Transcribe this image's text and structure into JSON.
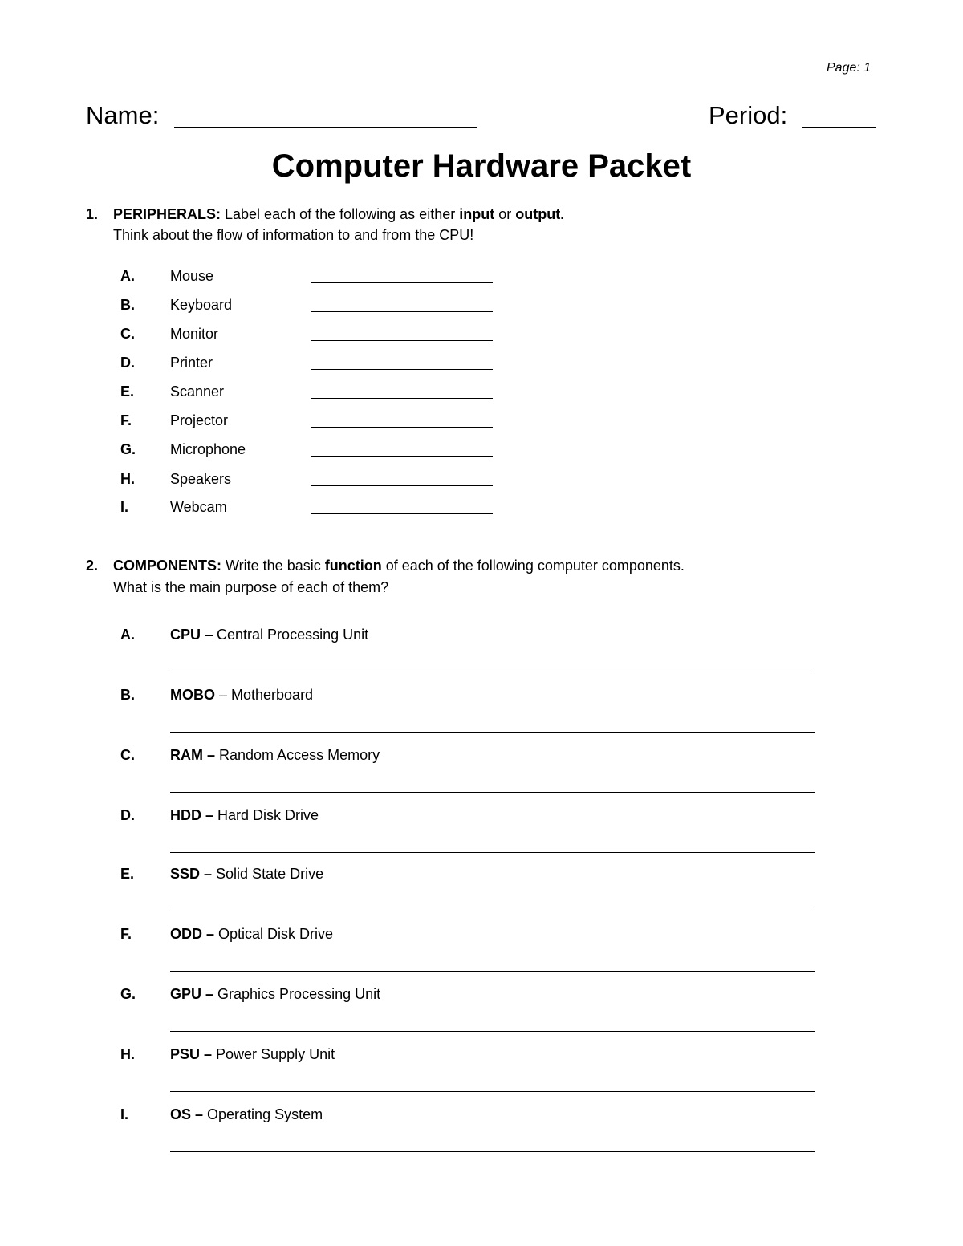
{
  "page_label": "Page: 1",
  "header": {
    "name_label": "Name:",
    "period_label": "Period:"
  },
  "title": "Computer Hardware Packet",
  "q1": {
    "number": "1.",
    "heading": "PERIPHERALS:",
    "text_a": " Label each of the following as either ",
    "bold_input": "input",
    "text_b": " or ",
    "bold_output": "output.",
    "line2": "Think about the flow of information to and from the CPU!",
    "items": [
      {
        "letter": "A.",
        "label": "Mouse"
      },
      {
        "letter": "B.",
        "label": "Keyboard"
      },
      {
        "letter": "C.",
        "label": "Monitor"
      },
      {
        "letter": "D.",
        "label": "Printer"
      },
      {
        "letter": "E.",
        "label": "Scanner"
      },
      {
        "letter": "F.",
        "label": "Projector"
      },
      {
        "letter": "G.",
        "label": "Microphone"
      },
      {
        "letter": "H.",
        "label": "Speakers"
      },
      {
        "letter": "I.",
        "label": "Webcam"
      }
    ]
  },
  "q2": {
    "number": "2.",
    "heading": "COMPONENTS:",
    "text_a": " Write the basic ",
    "bold_function": "function",
    "text_b": " of each of the following computer components.",
    "line2": "What is the main purpose of each of them?",
    "items": [
      {
        "letter": "A.",
        "abbr": "CPU",
        "full": " – Central Processing Unit"
      },
      {
        "letter": "B.",
        "abbr": "MOBO",
        "full": " – Motherboard"
      },
      {
        "letter": "C.",
        "abbr": "RAM –",
        "full": " Random Access Memory"
      },
      {
        "letter": "D.",
        "abbr": "HDD –",
        "full": " Hard Disk Drive"
      },
      {
        "letter": "E.",
        "abbr": "SSD –",
        "full": " Solid State Drive"
      },
      {
        "letter": "F.",
        "abbr": "ODD –",
        "full": " Optical Disk Drive"
      },
      {
        "letter": "G.",
        "abbr": "GPU –",
        "full": " Graphics Processing Unit"
      },
      {
        "letter": "H.",
        "abbr": "PSU –",
        "full": " Power Supply Unit"
      },
      {
        "letter": "I.",
        "abbr": "OS –",
        "full": " Operating System"
      }
    ]
  }
}
